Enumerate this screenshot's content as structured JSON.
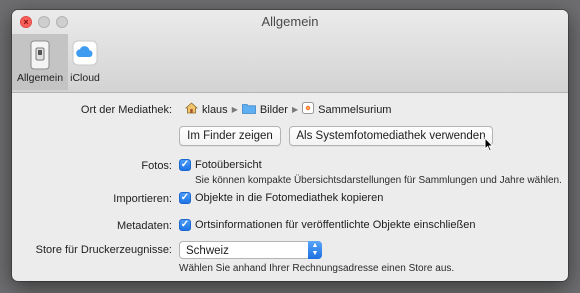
{
  "window": {
    "title": "Allgemein"
  },
  "tabs": [
    {
      "label": "Allgemein",
      "icon": "general-prefs-icon"
    },
    {
      "label": "iCloud",
      "icon": "icloud-icon"
    }
  ],
  "library": {
    "label": "Ort der Mediathek:",
    "path": [
      {
        "name": "klaus",
        "icon": "home-icon"
      },
      {
        "name": "Bilder",
        "icon": "folder-icon"
      },
      {
        "name": "Sammelsurium",
        "icon": "photos-library-icon"
      }
    ],
    "finder_button": "Im Finder zeigen",
    "system_library_button": "Als Systemfotomediathek verwenden"
  },
  "fotos": {
    "label": "Fotos:",
    "checkbox_label": "Fotoübersicht",
    "checked": true,
    "hint": "Sie können kompakte Übersichtsdarstellungen für Sammlungen und Jahre wählen."
  },
  "import": {
    "label": "Importieren:",
    "checkbox_label": "Objekte in die Fotomediathek kopieren",
    "checked": true
  },
  "metadata": {
    "label": "Metadaten:",
    "checkbox_label": "Ortsinformationen für veröffentlichte Objekte einschließen",
    "checked": true
  },
  "store": {
    "label": "Store für Druckerzeugnisse:",
    "selected": "Schweiz",
    "hint": "Wählen Sie anhand Ihrer Rechnungsadresse einen Store aus."
  },
  "colors": {
    "accent": "#1f75e6",
    "window_bg": "#ececec",
    "desktop_bg": "#6e6e70"
  }
}
